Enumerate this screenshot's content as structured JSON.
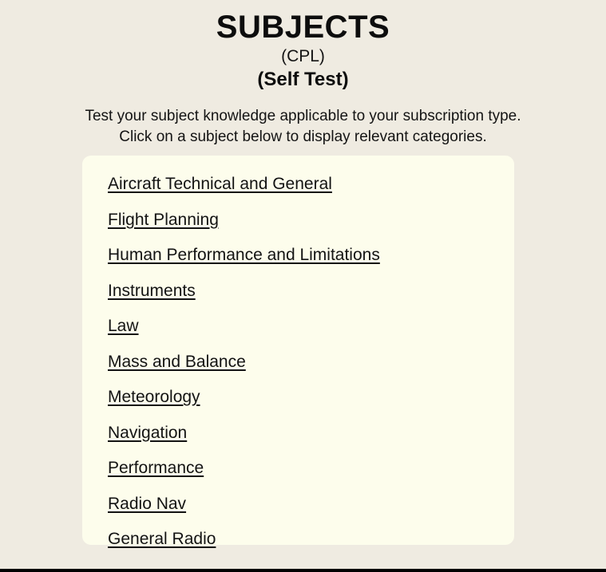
{
  "header": {
    "title": "SUBJECTS",
    "qualification": "(CPL)",
    "mode": "(Self Test)"
  },
  "intro": {
    "line1": "Test your subject knowledge applicable to your subscription type.",
    "line2": "Click on a subject below to display relevant categories."
  },
  "subjects": [
    {
      "label": "Aircraft Technical and General"
    },
    {
      "label": "Flight Planning"
    },
    {
      "label": "Human Performance and Limitations"
    },
    {
      "label": "Instruments"
    },
    {
      "label": "Law"
    },
    {
      "label": "Mass and Balance"
    },
    {
      "label": "Meteorology"
    },
    {
      "label": "Navigation"
    },
    {
      "label": "Performance"
    },
    {
      "label": "Radio Nav"
    },
    {
      "label": "General Radio"
    }
  ],
  "colors": {
    "page_background": "#efebe1",
    "panel_background": "#fdfdec",
    "text": "#131313",
    "bottom_bar": "#000000"
  }
}
